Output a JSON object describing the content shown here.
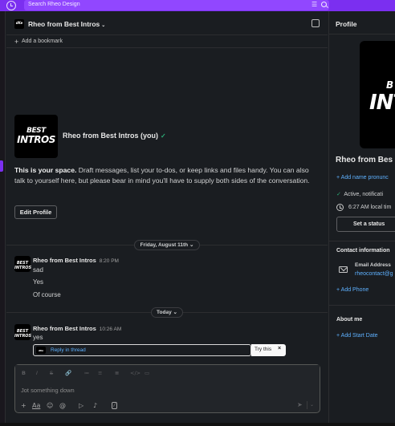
{
  "search": {
    "placeholder": "Search Rheo Design"
  },
  "channel": {
    "title": "Rheo from Best Intros",
    "chevron": "⌄",
    "avatar_text": "dKe",
    "add_bookmark": "Add a bookmark"
  },
  "intro": {
    "avatar_line1": "BEST",
    "avatar_line2": "INTROS",
    "name": "Rheo from Best Intros (you)",
    "status_emoji": "✓",
    "text_bold": "This is your space.",
    "text_rest": " Draft messages, list your to-dos, or keep links and files handy. You can also talk to yourself here, but please bear in mind you'll have to supply both sides of the conversation.",
    "edit_button": "Edit Profile"
  },
  "dividers": {
    "first": "Friday, August 11th",
    "second": "Today"
  },
  "messages": [
    {
      "sender": "Rheo from Best Intros",
      "time": "8:20 PM",
      "lines": [
        "sad",
        "Yes",
        "Of course"
      ],
      "avatar_text": "BEST INTROS"
    },
    {
      "sender": "Rheo from Best Intros",
      "time": "10:26 AM",
      "lines": [
        "yes"
      ],
      "avatar_text": "BEST INTROS"
    }
  ],
  "thread": {
    "label": "Reply in thread",
    "try": "Try this",
    "close": "×"
  },
  "composer": {
    "placeholder": "Jot something down",
    "toolbar": [
      "B",
      "I",
      "S",
      "🔗",
      "≔",
      "≡",
      "≣",
      "</>",
      "▭"
    ],
    "actions": [
      "+",
      "Aa",
      "☺",
      "@",
      "▷",
      "♪",
      "⁄"
    ],
    "send": "➤",
    "send_menu": "⌄"
  },
  "profile": {
    "title": "Profile",
    "image_line1": "B",
    "image_line2": "INT",
    "name": "Rheo from Bes",
    "add_pronunciation": "Add name pronunc",
    "status": "Active, notificati",
    "local_time": "6:27 AM local tim",
    "set_status": "Set a status",
    "contact_heading": "Contact information",
    "email_label": "Email Address",
    "email_value": "rheocontact@g",
    "add_phone": "Add Phone",
    "about_heading": "About me",
    "add_start_date": "Add Start Date"
  }
}
